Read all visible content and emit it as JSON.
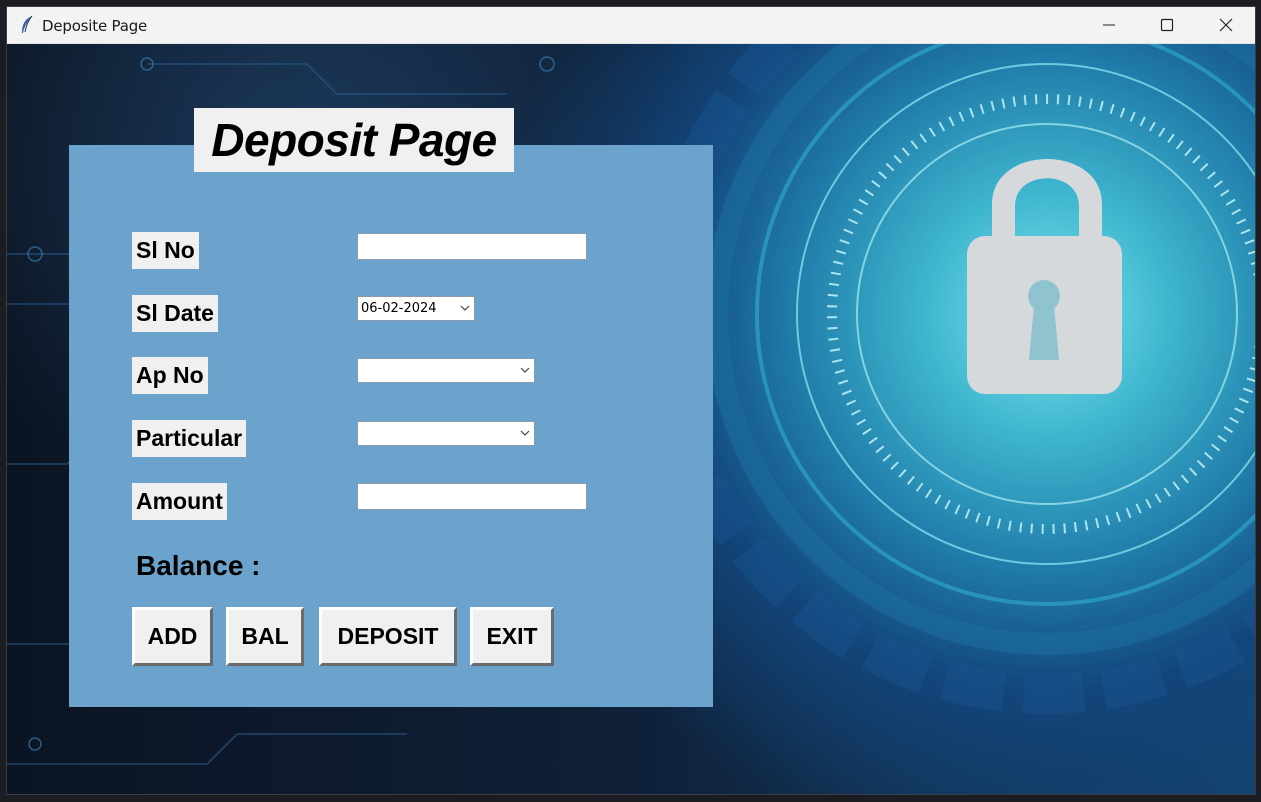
{
  "window": {
    "title": "Deposite Page",
    "controls": {
      "minimize": "minimize",
      "maximize": "maximize",
      "close": "close"
    }
  },
  "form": {
    "heading": "Deposit Page",
    "fields": {
      "sl_no": {
        "label": "Sl No",
        "value": ""
      },
      "sl_date": {
        "label": "Sl Date",
        "value": "06-02-2024"
      },
      "ap_no": {
        "label": "Ap No",
        "value": ""
      },
      "particular": {
        "label": "Particular",
        "value": ""
      },
      "amount": {
        "label": "Amount",
        "value": ""
      }
    },
    "balance_label": "Balance :",
    "buttons": {
      "add": "ADD",
      "bal": "BAL",
      "deposit": "DEPOSIT",
      "exit": "EXIT"
    }
  },
  "background": {
    "accent": "#3fb7cf",
    "panel_color": "#6ba3cc",
    "icon": "padlock-icon"
  }
}
